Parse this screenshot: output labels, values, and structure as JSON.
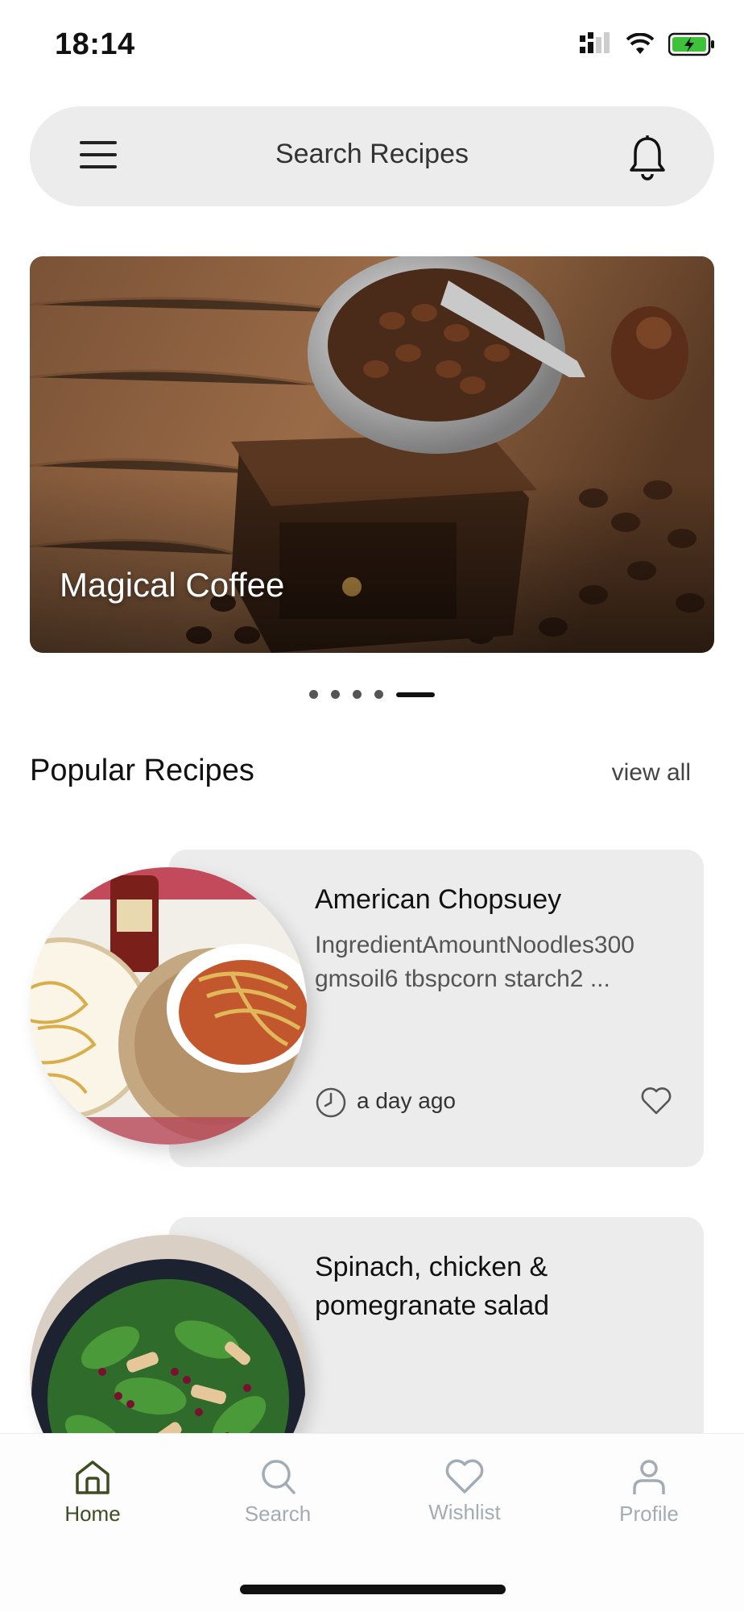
{
  "status_bar": {
    "time": "18:14"
  },
  "search": {
    "placeholder": "Search Recipes"
  },
  "carousel": {
    "title": "Magical Coffee",
    "slide_count": 5,
    "active_slide": 5
  },
  "section": {
    "title": "Popular Recipes",
    "view_all": "view all"
  },
  "recipes": [
    {
      "title": "American Chopsuey",
      "description": "IngredientAmountNoodles300 gmsoil6 tbspcorn starch2 ...",
      "time": "a day ago",
      "wishlisted": false
    },
    {
      "title": "Spinach, chicken & pomegranate salad"
    }
  ],
  "nav": {
    "items": [
      {
        "label": "Home",
        "active": true
      },
      {
        "label": "Search",
        "active": false
      },
      {
        "label": "Wishlist",
        "active": false
      },
      {
        "label": "Profile",
        "active": false
      }
    ]
  },
  "colors": {
    "accent": "#3c4d22",
    "inactive": "#a3acb5",
    "card_bg": "#ececec"
  }
}
